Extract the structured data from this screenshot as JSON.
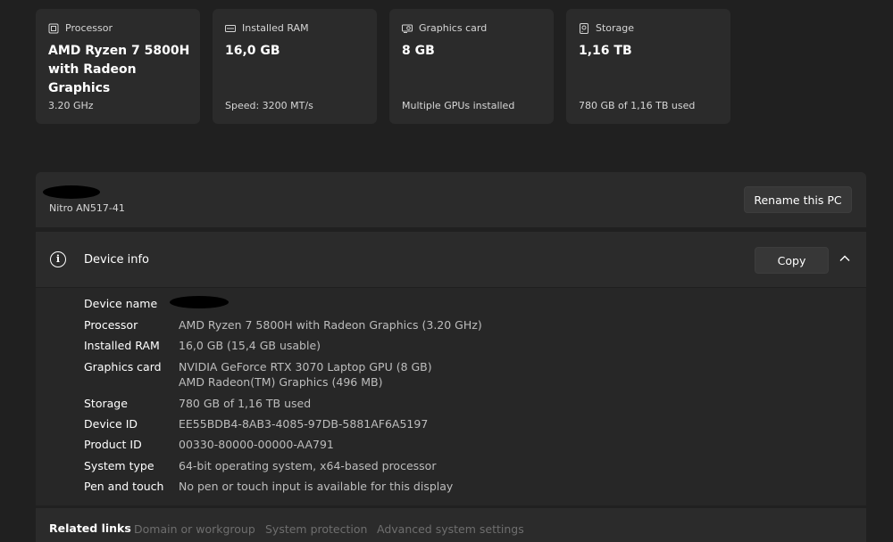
{
  "specs": [
    {
      "icon": "processor-icon",
      "title": "Processor",
      "value": "AMD Ryzen 7 5800H with Radeon Graphics",
      "sub": "3.20 GHz"
    },
    {
      "icon": "ram-icon",
      "title": "Installed RAM",
      "value": "16,0 GB",
      "sub": "Speed: 3200 MT/s"
    },
    {
      "icon": "graphics-card-icon",
      "title": "Graphics card",
      "value": "8 GB",
      "sub": "Multiple GPUs installed"
    },
    {
      "icon": "storage-icon",
      "title": "Storage",
      "value": "1,16 TB",
      "sub": "780 GB of 1,16 TB used"
    }
  ],
  "pc": {
    "model": "Nitro AN517-41",
    "rename_label": "Rename this PC"
  },
  "device_info": {
    "title": "Device info",
    "copy_label": "Copy",
    "rows": [
      {
        "label": "Device name",
        "value": ""
      },
      {
        "label": "Processor",
        "value": "AMD Ryzen 7 5800H with Radeon Graphics (3.20 GHz)"
      },
      {
        "label": "Installed RAM",
        "value": "16,0 GB (15,4 GB usable)"
      },
      {
        "label": "Graphics card",
        "value": "NVIDIA GeForce RTX 3070 Laptop GPU (8 GB)",
        "value2": "AMD Radeon(TM) Graphics (496 MB)"
      },
      {
        "label": "Storage",
        "value": "780 GB of 1,16 TB used"
      },
      {
        "label": "Device ID",
        "value": "EE55BDB4-8AB3-4085-97DB-5881AF6A5197"
      },
      {
        "label": "Product ID",
        "value": "00330-80000-00000-AA791"
      },
      {
        "label": "System type",
        "value": "64-bit operating system, x64-based processor"
      },
      {
        "label": "Pen and touch",
        "value": "No pen or touch input is available for this display"
      }
    ]
  },
  "related": {
    "title": "Related links",
    "links": [
      "Domain or workgroup",
      "System protection",
      "Advanced system settings"
    ]
  }
}
